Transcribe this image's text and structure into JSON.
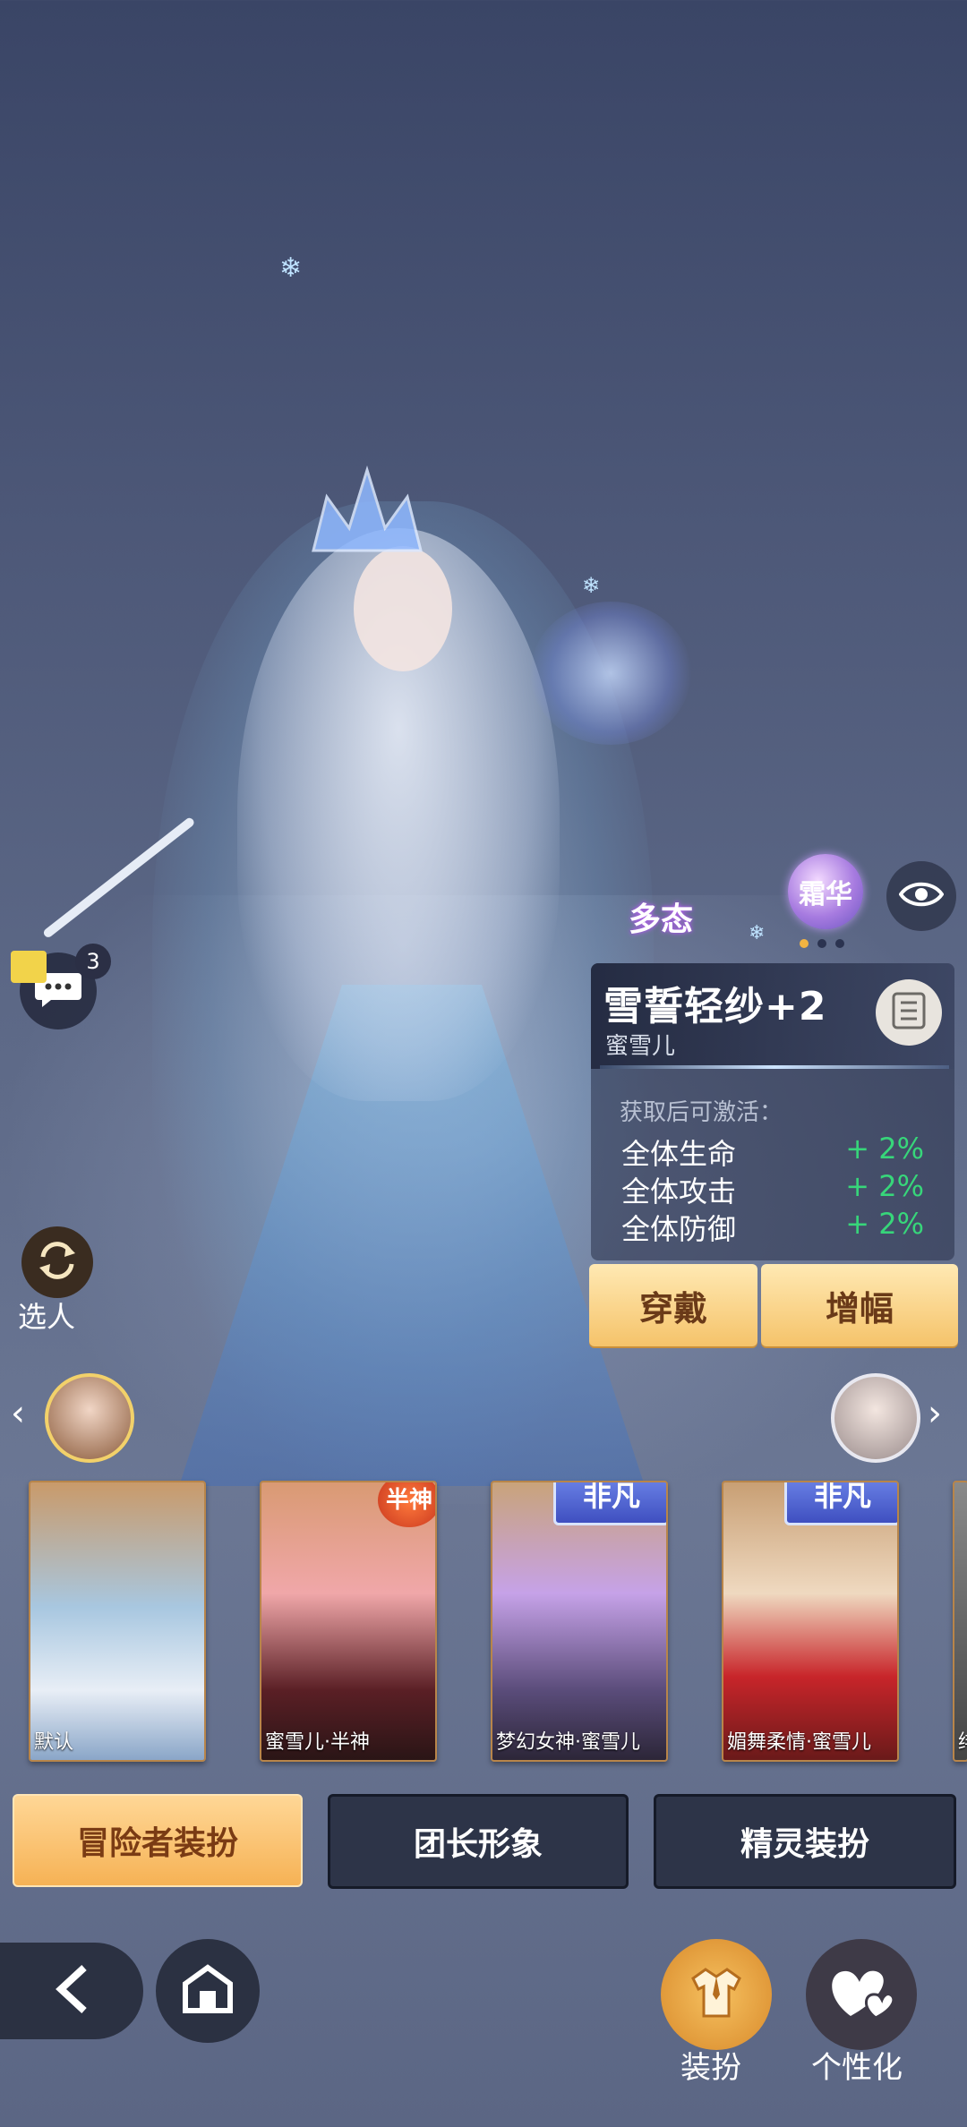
{
  "outfit": {
    "name": "雪誓轻纱+2",
    "owner": "蜜雪儿",
    "activate_hint": "获取后可激活：",
    "stats": [
      {
        "label": "全体生命",
        "value": "+ 2%"
      },
      {
        "label": "全体攻击",
        "value": "+ 2%"
      },
      {
        "label": "全体防御",
        "value": "+ 2%"
      }
    ],
    "wear_label": "穿戴",
    "boost_label": "增幅"
  },
  "badges": {
    "multi_label": "多态",
    "frost_label": "霜华"
  },
  "chat": {
    "count": "3"
  },
  "swap_label": "选人",
  "cards": [
    {
      "caption": "默认",
      "tag": ""
    },
    {
      "caption": "蜜雪儿·半神",
      "tag": "半神"
    },
    {
      "caption": "梦幻女神·蜜雪儿",
      "tag": "非凡"
    },
    {
      "caption": "媚舞柔情·蜜雪儿",
      "tag": "非凡"
    },
    {
      "caption": "绯",
      "tag": ""
    }
  ],
  "tabs": [
    {
      "label": "冒险者装扮"
    },
    {
      "label": "团长形象"
    },
    {
      "label": "精灵装扮"
    }
  ],
  "nav": {
    "dress_label": "装扮",
    "personal_label": "个性化"
  },
  "colors": {
    "gold": "#f5c36a",
    "stat_green": "#37d67a",
    "accent_orange": "#f3b442"
  }
}
